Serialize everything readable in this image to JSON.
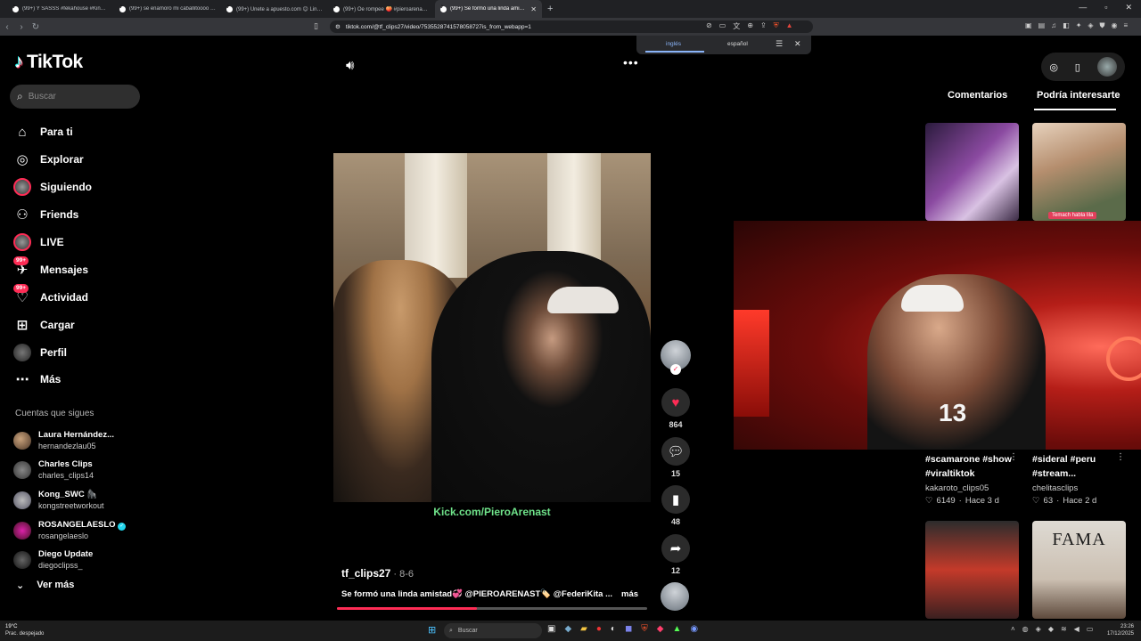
{
  "browser": {
    "tabs": [
      {
        "label": "(99+) Y SASSS #fekahouse #Kingteto..."
      },
      {
        "label": "(99+) se enamoró mi caballitoooo am..."
      },
      {
        "label": "(99+) Únete a apuesto.com 😊 Link..."
      },
      {
        "label": "(99+) Oe rompee 🍑 #pieroarenas #..."
      },
      {
        "label": "(99+) Se formó una linda amistad..."
      }
    ],
    "new_tab": "+",
    "url": "tiktok.com/@tf_clips27/video/7535528741578058727is_from_webapp=1",
    "translate": {
      "lang_source": "inglés",
      "lang_target": "español"
    }
  },
  "sidebar": {
    "logo": "TikTok",
    "search_placeholder": "Buscar",
    "nav": [
      {
        "label": "Para ti",
        "icon": "home-icon"
      },
      {
        "label": "Explorar",
        "icon": "compass-icon"
      },
      {
        "label": "Siguiendo",
        "icon": "following-avatar"
      },
      {
        "label": "Friends",
        "icon": "friends-icon"
      },
      {
        "label": "LIVE",
        "icon": "live-avatar"
      },
      {
        "label": "Mensajes",
        "icon": "messages-icon",
        "badge": "99+"
      },
      {
        "label": "Actividad",
        "icon": "activity-icon",
        "badge": "99+"
      },
      {
        "label": "Cargar",
        "icon": "upload-icon"
      },
      {
        "label": "Perfil",
        "icon": "profile-avatar"
      },
      {
        "label": "Más",
        "icon": "more-dots-icon"
      }
    ],
    "following_title": "Cuentas que sigues",
    "following": [
      {
        "name": "Laura Hernández...",
        "handle": "hernandezlau05"
      },
      {
        "name": "Charles Clips",
        "handle": "charles_clips14"
      },
      {
        "name": "Kong_SWC 🦍",
        "handle": "kongstreetworkout"
      },
      {
        "name": "ROSANGELAESLO",
        "handle": "rosangelaeslo",
        "verified": true
      },
      {
        "name": "Diego Update",
        "handle": "diegoclipss_"
      }
    ],
    "see_more": "Ver más"
  },
  "video": {
    "watermark": "Kick.com/PieroArenast",
    "author": "tf_clips27",
    "date": " · 8-6",
    "caption": "Se formó una linda amistad💞 @PIEROARENAST🏷️ @FederiKita ...",
    "more": "más",
    "progress_percent": 45,
    "likes": "864",
    "comments": "15",
    "saves": "48",
    "shares": "12"
  },
  "right_panel": {
    "tab_comments": "Comentarios",
    "tab_interest": "Podría interesarte",
    "thumb2_tag": "Temach habla lila",
    "thumb4_title": "FAMA",
    "cards": [
      {
        "title": "#scamarone #show #viraltiktok",
        "user": "kakaroto_clips05",
        "likes": "6149",
        "age": "Hace 3 d"
      },
      {
        "title": "#sideral #peru #stream...",
        "user": "chelitasclips",
        "likes": "63",
        "age": "Hace 2 d"
      }
    ]
  },
  "taskbar": {
    "temp": "19°C",
    "weather": "Prac. despejado",
    "search": "Buscar",
    "time": "23:26",
    "date": "17/12/2025"
  },
  "colors": {
    "accent": "#fe2c55",
    "watermark": "#6fe38a",
    "background": "#000000"
  }
}
